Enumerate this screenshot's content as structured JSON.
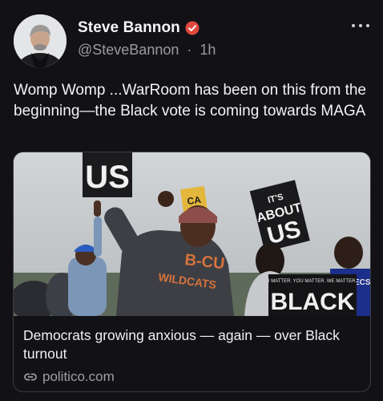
{
  "author": {
    "display_name": "Steve Bannon",
    "handle": "@SteveBannon",
    "separator": "·",
    "time_ago": "1h",
    "verified_color": "#e0483e"
  },
  "post": {
    "text": "Womp Womp ...WarRoom has been on this from the beginning—the Black vote is coming towards MAGA"
  },
  "link_card": {
    "title": "Democrats growing anxious — again — over Black turnout",
    "domain": "politico.com",
    "image": {
      "signs": [
        "US",
        "IT'S ABOUT US",
        "BLACK",
        "I MATTER. YOU MATTER. WE MATTER.",
        "CA"
      ],
      "shirt_text": [
        "B-CU",
        "WILDCATS"
      ]
    }
  },
  "icons": {
    "more": "more-horizontal-icon",
    "verified": "verified-badge-icon",
    "link": "link-icon"
  }
}
